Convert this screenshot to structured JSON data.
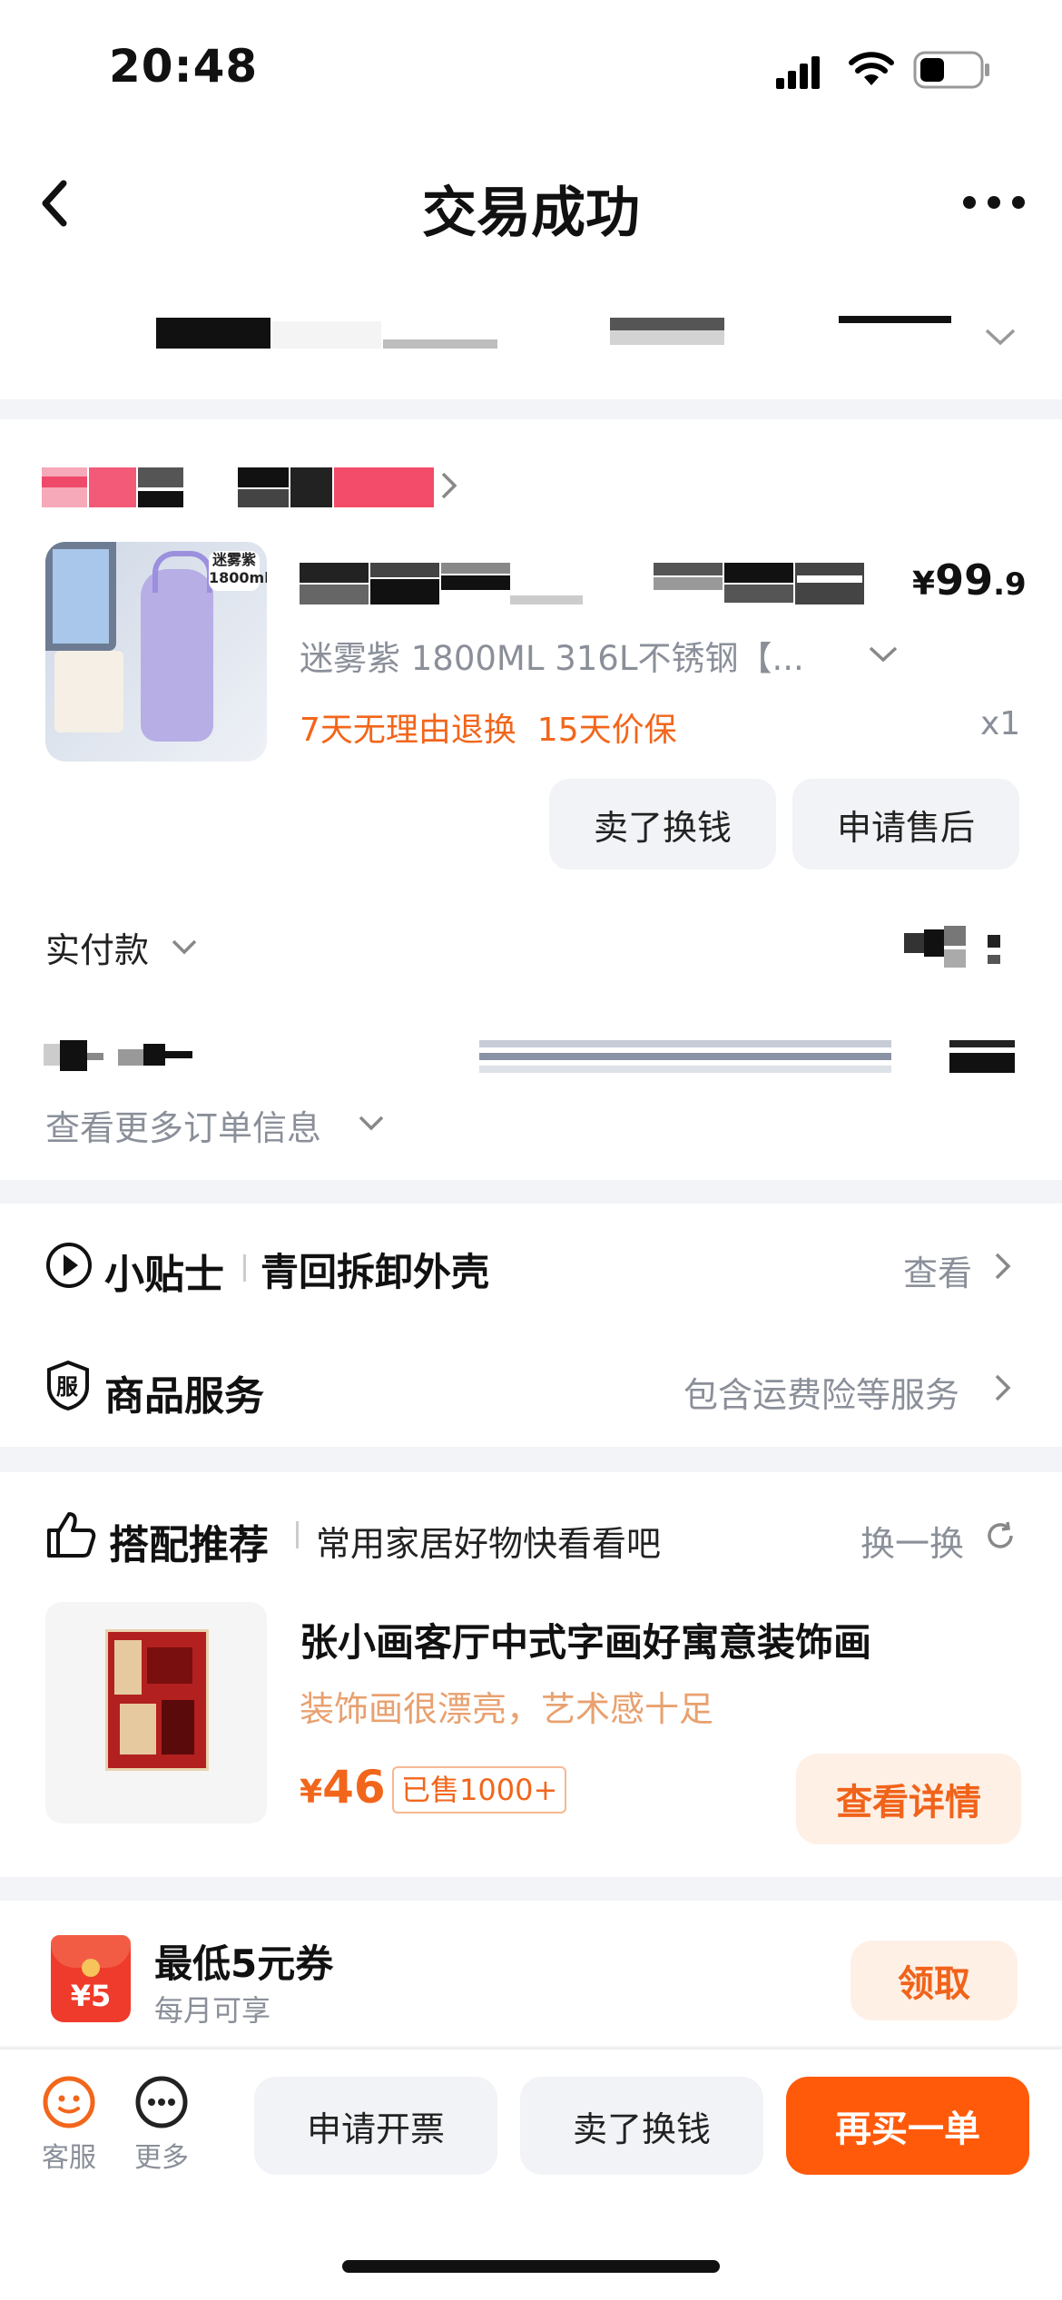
{
  "status_bar": {
    "time": "20:48"
  },
  "header": {
    "title": "交易成功"
  },
  "order": {
    "price_symbol": "¥",
    "price_int": "99",
    "price_dec": ".9",
    "variant": "迷雾紫 1800ML 316L不锈钢【...",
    "guarantee": "7天无理由退换  15天价保",
    "quantity": "x1",
    "thumb_label_1": "迷雾紫",
    "thumb_label_2": "1800ml",
    "sell_button": "卖了换钱",
    "aftersale_button": "申请售后",
    "paid_label": "实付款",
    "more_info": "查看更多订单信息"
  },
  "tips": {
    "title": "小贴士",
    "subtitle": "青回拆卸外壳",
    "action": "查看"
  },
  "service": {
    "icon_char": "服",
    "title": "商品服务",
    "action": "包含运费险等服务"
  },
  "recommend": {
    "title": "搭配推荐",
    "subtitle": "常用家居好物快看看吧",
    "refresh": "换一换",
    "item": {
      "title": "张小画客厅中式字画好寓意装饰画",
      "desc": "装饰画很漂亮，艺术感十足",
      "price_symbol": "¥",
      "price": "46",
      "sold": "已售1000+",
      "action": "查看详情"
    }
  },
  "coupon": {
    "badge": "¥5",
    "title": "最低5元券",
    "subtitle": "每月可享",
    "action": "领取"
  },
  "bottom_bar": {
    "service_label": "客服",
    "more_label": "更多",
    "invoice_button": "申请开票",
    "sell_button": "卖了换钱",
    "rebuy_button": "再买一单"
  },
  "colors": {
    "accent": "#ff5a0a",
    "orange_text": "#f2661b",
    "gray_text": "#8a8f99",
    "background": "#f3f4f7"
  }
}
